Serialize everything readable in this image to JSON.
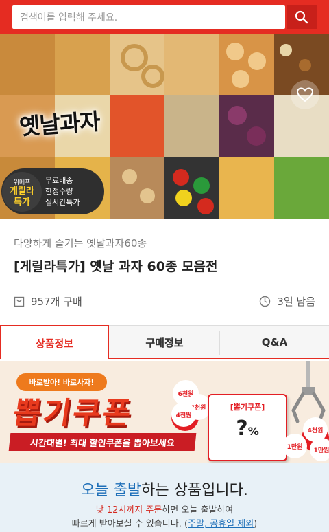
{
  "search": {
    "placeholder": "검색어를 입력해 주세요."
  },
  "hero": {
    "title": "옛날과자",
    "promo": {
      "brand": "위메프",
      "badge_line1": "게릴라",
      "badge_line2": "특가",
      "lines": [
        "무료배송",
        "한정수량",
        "실시간특가"
      ]
    }
  },
  "product": {
    "subtitle": "다양하게 즐기는 옛날과자60종",
    "title": "[게릴라특가] 옛날 과자 60종 모음전",
    "purchase_count": "957개 구매",
    "time_remaining": "3일 남음"
  },
  "tabs": [
    {
      "label": "상품정보",
      "active": true
    },
    {
      "label": "구매정보",
      "active": false
    },
    {
      "label": "Q&A",
      "active": false
    }
  ],
  "coupon_banner": {
    "top_label": "바로받아! 바로사자!",
    "title": "뽑기쿠폰",
    "tagline": "시간대별! 최대 할인쿠폰을 뽑아보세요",
    "card_label": "[뽑기쿠폰]",
    "card_value": "?",
    "card_unit": "%",
    "capsules": [
      "6천원",
      "7천원",
      "4천원",
      "4천원",
      "1만원",
      "1만원"
    ]
  },
  "shipping": {
    "heading_highlight": "오늘 출발",
    "heading_rest": "하는 상품입니다.",
    "line1_red": "낮 12시까지 주문",
    "line1_rest": "하면 오늘 출발하여",
    "line2_pre": "빠르게 받아보실 수 있습니다. (",
    "line2_link": "주말, 공휴일 제외",
    "line2_post": ")"
  },
  "colors": {
    "brand_red": "#e52c22",
    "coupon_red": "#e31e24",
    "highlight_blue": "#1e6fb8",
    "promo_yellow": "#ffd12a"
  }
}
